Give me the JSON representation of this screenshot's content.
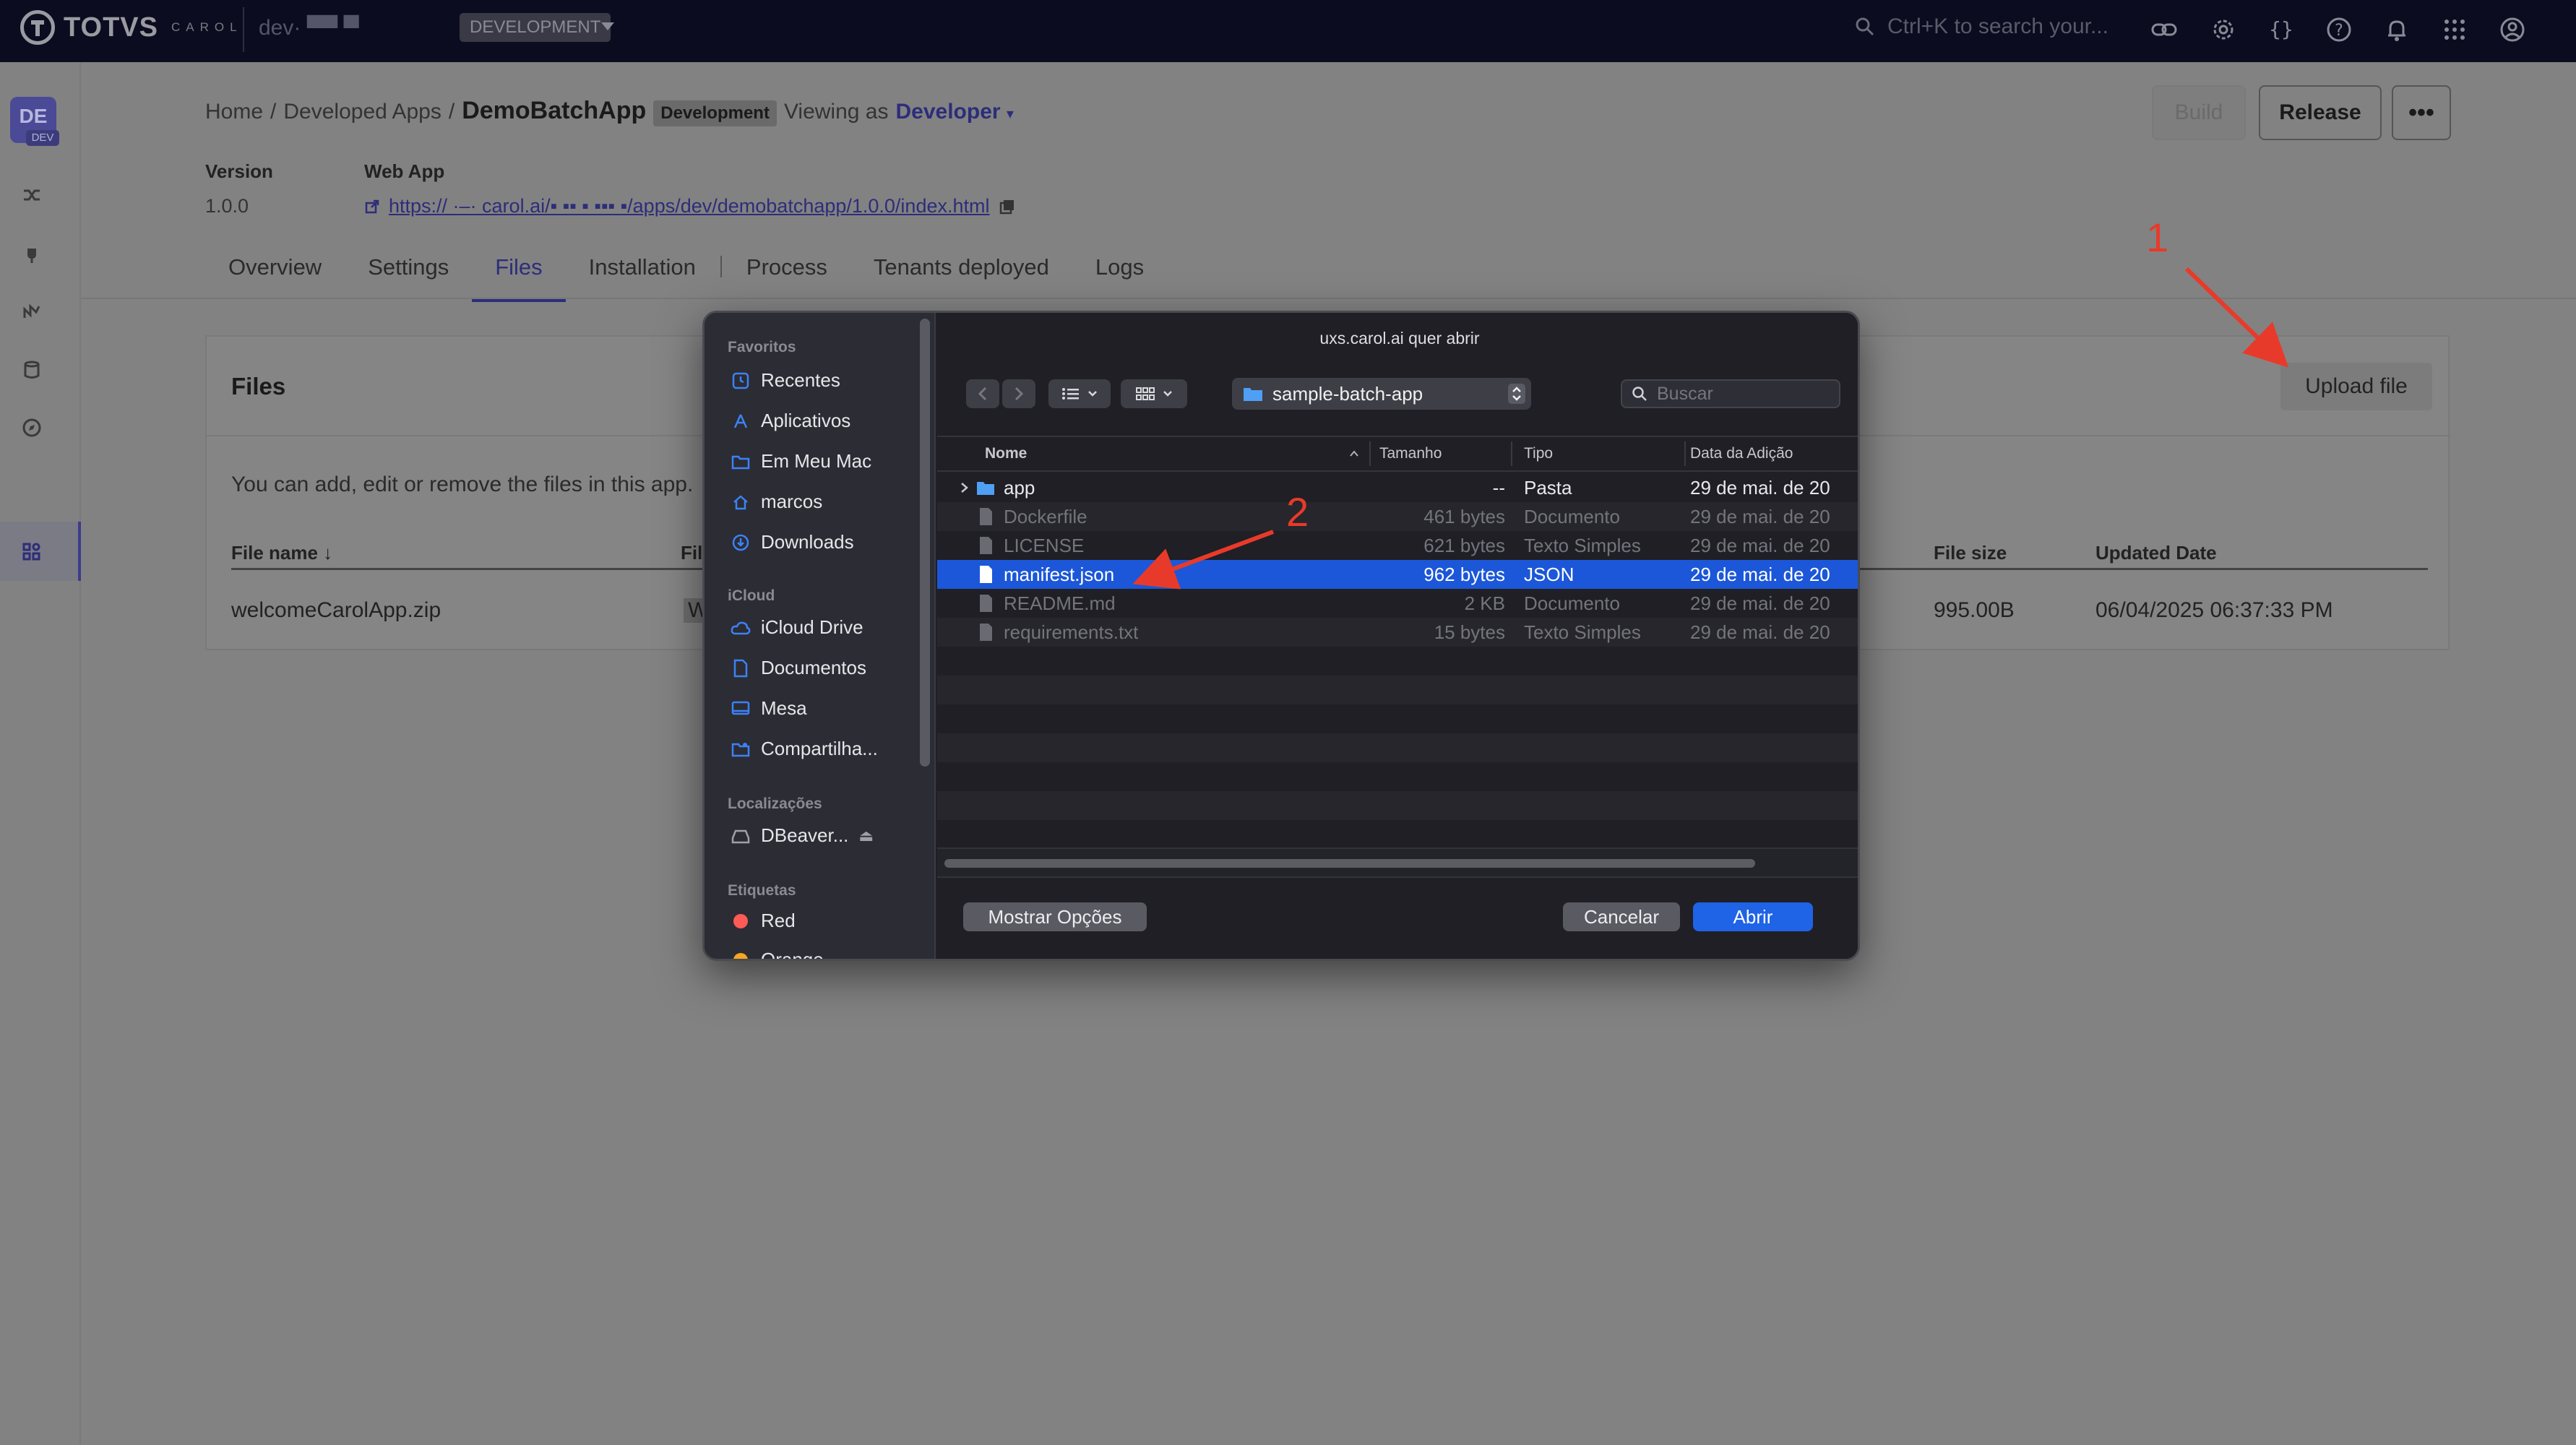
{
  "topbar": {
    "logo_text": "TOTVS",
    "logo_sub": "CAROL",
    "env_name": "dev· ▀▀ ▀",
    "env_badge": "DEVELOPMENT",
    "search_placeholder": "Ctrl+K to search your...",
    "icons": [
      "link-icon",
      "gear-icon",
      "code-braces-icon",
      "help-icon",
      "bell-icon",
      "apps-grid-icon",
      "user-circle-icon"
    ]
  },
  "rail": {
    "avatar_initials": "DE",
    "avatar_badge": "DEV",
    "icons": [
      "connectors-icon",
      "plug-icon",
      "pipeline-icon",
      "database-icon",
      "compass-icon",
      "apps-icon"
    ]
  },
  "header": {
    "breadcrumb": [
      "Home",
      "Developed Apps"
    ],
    "breadcrumb_sep": "/",
    "app_name": "DemoBatchApp",
    "env_badge": "Development",
    "viewing_as_label": "Viewing as",
    "viewing_as_role": "Developer",
    "build_label": "Build",
    "release_label": "Release",
    "more_label": "•••"
  },
  "meta": {
    "version_label": "Version",
    "version_value": "1.0.0",
    "webapp_label": "Web App",
    "webapp_url": "https:// ·–· carol.ai/▪ ▪▪ ▪ ▪▪▪ ▪/apps/dev/demobatchapp/1.0.0/index.html"
  },
  "tabs": [
    {
      "label": "Overview",
      "active": false
    },
    {
      "label": "Settings",
      "active": false
    },
    {
      "label": "Files",
      "active": true
    },
    {
      "label": "Installation",
      "active": false
    },
    {
      "label": "Process",
      "active": false
    },
    {
      "label": "Tenants deployed",
      "active": false
    },
    {
      "label": "Logs",
      "active": false
    }
  ],
  "files": {
    "title": "Files",
    "upload_label": "Upload file",
    "description": "You can add, edit or remove the files in this app.",
    "columns": {
      "name": "File name",
      "type": "Fil",
      "size": "File size",
      "updated": "Updated Date"
    },
    "rows": [
      {
        "name": "welcomeCarolApp.zip",
        "type": "W",
        "size": "995.00B",
        "updated": "06/04/2025 06:37:33 PM"
      }
    ]
  },
  "dialog": {
    "title": "uxs.carol.ai quer abrir",
    "current_folder": "sample-batch-app",
    "search_placeholder": "Buscar",
    "sidebar": {
      "favorites_label": "Favoritos",
      "favorites": [
        {
          "label": "Recentes",
          "icon": "clock-icon"
        },
        {
          "label": "Aplicativos",
          "icon": "applications-icon"
        },
        {
          "label": "Em Meu Mac",
          "icon": "folder-icon"
        },
        {
          "label": "marcos",
          "icon": "home-icon"
        },
        {
          "label": "Downloads",
          "icon": "download-icon"
        }
      ],
      "icloud_label": "iCloud",
      "icloud": [
        {
          "label": "iCloud Drive",
          "icon": "cloud-icon"
        },
        {
          "label": "Documentos",
          "icon": "document-icon"
        },
        {
          "label": "Mesa",
          "icon": "desktop-icon"
        },
        {
          "label": "Compartilha...",
          "icon": "shared-folder-icon"
        }
      ],
      "locations_label": "Localizações",
      "locations": [
        {
          "label": "DBeaver...",
          "icon": "drive-icon"
        }
      ],
      "tags_label": "Etiquetas",
      "tags": [
        {
          "label": "Red",
          "color": "#ff5b56"
        },
        {
          "label": "Orange",
          "color": "#f5a623"
        }
      ]
    },
    "columns": {
      "name": "Nome",
      "size": "Tamanho",
      "kind": "Tipo",
      "date": "Data da Adição"
    },
    "files": [
      {
        "name": "app",
        "size": "--",
        "kind": "Pasta",
        "date": "29 de mai. de 20",
        "folder": true,
        "state": "normal"
      },
      {
        "name": "Dockerfile",
        "size": "461 bytes",
        "kind": "Documento",
        "date": "29 de mai. de 20",
        "folder": false,
        "state": "dim"
      },
      {
        "name": "LICENSE",
        "size": "621 bytes",
        "kind": "Texto Simples",
        "date": "29 de mai. de 20",
        "folder": false,
        "state": "dim"
      },
      {
        "name": "manifest.json",
        "size": "962 bytes",
        "kind": "JSON",
        "date": "29 de mai. de 20",
        "folder": false,
        "state": "selected"
      },
      {
        "name": "README.md",
        "size": "2 KB",
        "kind": "Documento",
        "date": "29 de mai. de 20",
        "folder": false,
        "state": "dim"
      },
      {
        "name": "requirements.txt",
        "size": "15 bytes",
        "kind": "Texto Simples",
        "date": "29 de mai. de 20",
        "folder": false,
        "state": "dim"
      }
    ],
    "options_label": "Mostrar Opções",
    "cancel_label": "Cancelar",
    "open_label": "Abrir"
  },
  "annotations": {
    "step1": "1",
    "step2": "2",
    "color": "#e83a2a"
  },
  "colors": {
    "topbar": "#0c0c20",
    "accent": "#2d2d7a",
    "selection": "#1b57d8",
    "primary_button": "#1f63e6"
  }
}
